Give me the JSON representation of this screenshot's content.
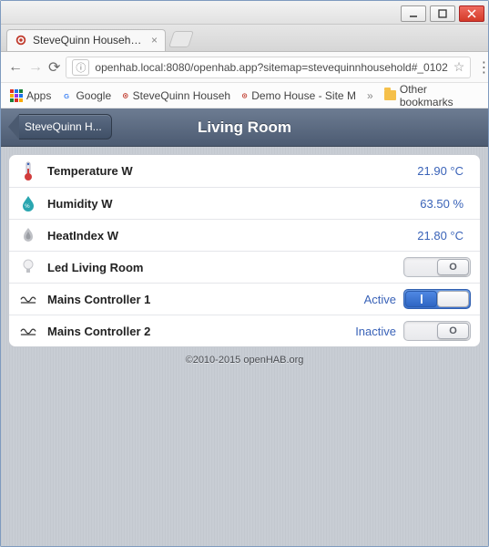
{
  "window": {
    "tab_title": "SteveQuinn Household"
  },
  "browser": {
    "url_display": "openhab.local:8080/openhab.app?sitemap=stevequinnhousehold#_0102",
    "bookmarks": {
      "apps_label": "Apps",
      "items": [
        {
          "label": "Google"
        },
        {
          "label": "SteveQuinn Househ"
        },
        {
          "label": "Demo House - Site M"
        }
      ],
      "other_label": "Other bookmarks"
    }
  },
  "page": {
    "back_label": "SteveQuinn H...",
    "title": "Living Room",
    "rows": [
      {
        "kind": "reading",
        "icon": "thermometer",
        "label": "Temperature W",
        "value": "21.90 °C"
      },
      {
        "kind": "reading",
        "icon": "humidity",
        "label": "Humidity W",
        "value": "63.50 %"
      },
      {
        "kind": "reading",
        "icon": "heatindex",
        "label": "HeatIndex W",
        "value": "21.80 °C"
      },
      {
        "kind": "switch",
        "icon": "bulb",
        "label": "Led Living Room",
        "status": "",
        "on": false
      },
      {
        "kind": "switch",
        "icon": "wave",
        "label": "Mains Controller 1",
        "status": "Active",
        "on": true
      },
      {
        "kind": "switch",
        "icon": "wave",
        "label": "Mains Controller 2",
        "status": "Inactive",
        "on": false
      }
    ],
    "footer": "©2010-2015 openHAB.org"
  }
}
